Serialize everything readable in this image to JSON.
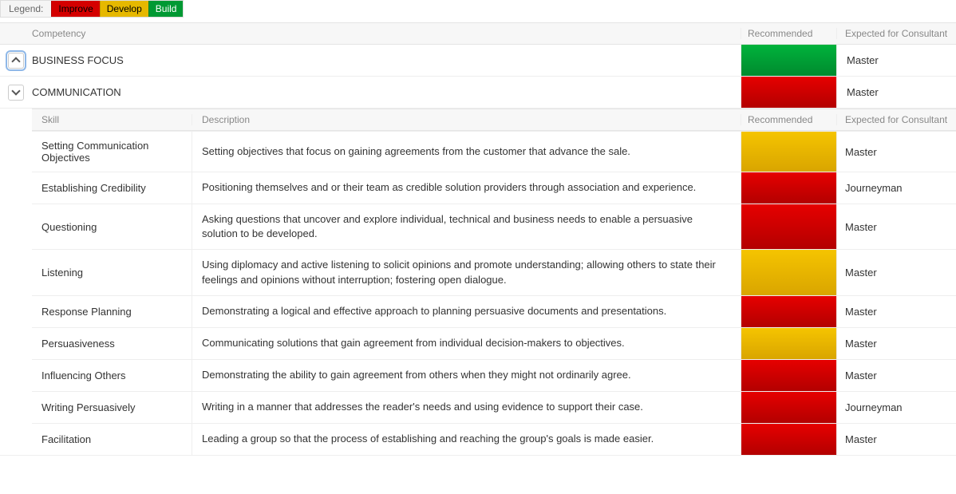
{
  "legend": {
    "label": "Legend:",
    "improve": "Improve",
    "develop": "Develop",
    "build": "Build"
  },
  "colors": {
    "improve": "#d40000",
    "develop": "#e6b800",
    "build": "#009933"
  },
  "headers": {
    "competency": "Competency",
    "recommended": "Recommended",
    "expected": "Expected for Consultant",
    "skill": "Skill",
    "description": "Description"
  },
  "competencies": [
    {
      "name": "BUSINESS FOCUS",
      "expanded": false,
      "status": "green",
      "expected": "Master"
    },
    {
      "name": "COMMUNICATION",
      "expanded": true,
      "status": "red",
      "expected": "Master",
      "skills": [
        {
          "name": "Setting Communication Objectives",
          "description": "Setting objectives that focus on gaining agreements from the customer that advance the sale.",
          "status": "yellow",
          "expected": "Master"
        },
        {
          "name": "Establishing Credibility",
          "description": "Positioning themselves and or their team as credible solution providers through association and experience.",
          "status": "red",
          "expected": "Journeyman"
        },
        {
          "name": "Questioning",
          "description": "Asking questions that uncover and explore individual, technical and business needs to enable a persuasive solution to be developed.",
          "status": "red",
          "expected": "Master"
        },
        {
          "name": "Listening",
          "description": "Using diplomacy and active listening to solicit opinions and promote understanding; allowing others to state their feelings and opinions without interruption; fostering open dialogue.",
          "status": "yellow",
          "expected": "Master"
        },
        {
          "name": "Response Planning",
          "description": "Demonstrating a logical and effective approach to planning persuasive documents and presentations.",
          "status": "red",
          "expected": "Master"
        },
        {
          "name": "Persuasiveness",
          "description": "Communicating solutions that gain agreement from individual decision-makers to objectives.",
          "status": "yellow",
          "expected": "Master"
        },
        {
          "name": "Influencing Others",
          "description": "Demonstrating the ability to gain agreement from others when they might not ordinarily agree.",
          "status": "red",
          "expected": "Master"
        },
        {
          "name": "Writing Persuasively",
          "description": "Writing in a manner that addresses the reader's needs and using evidence to support their case.",
          "status": "red",
          "expected": "Journeyman"
        },
        {
          "name": "Facilitation",
          "description": "Leading a group so that the process of establishing and reaching the group's goals is made easier.",
          "status": "red",
          "expected": "Master"
        }
      ]
    }
  ]
}
